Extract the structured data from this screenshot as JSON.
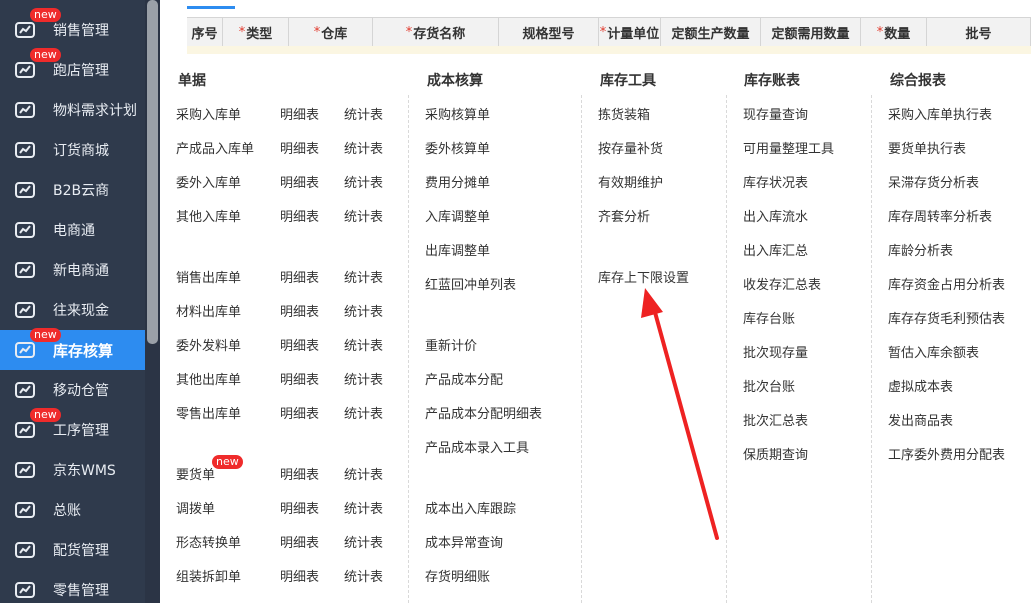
{
  "sidebar": {
    "items": [
      {
        "label": "销售管理",
        "icon": "sales-chart-icon",
        "new": true
      },
      {
        "label": "跑店管理",
        "icon": "store-visit-icon",
        "new": true
      },
      {
        "label": "物料需求计划",
        "icon": "material-plan-icon",
        "new": false
      },
      {
        "label": "订货商城",
        "icon": "mall-icon",
        "new": false
      },
      {
        "label": "B2B云商",
        "icon": "b2b-icon",
        "new": false
      },
      {
        "label": "电商通",
        "icon": "ecommerce-icon",
        "new": false
      },
      {
        "label": "新电商通",
        "icon": "new-ecommerce-icon",
        "new": false
      },
      {
        "label": "往来现金",
        "icon": "cash-transfer-icon",
        "new": false
      },
      {
        "label": "库存核算",
        "icon": "inventory-icon",
        "new": true,
        "active": true
      },
      {
        "label": "移动仓管",
        "icon": "mobile-warehouse-icon",
        "new": false
      },
      {
        "label": "工序管理",
        "icon": "process-icon",
        "new": true
      },
      {
        "label": "京东WMS",
        "icon": "truck-icon",
        "new": false
      },
      {
        "label": "总账",
        "icon": "ledger-icon",
        "new": false
      },
      {
        "label": "配货管理",
        "icon": "distribution-icon",
        "new": false
      },
      {
        "label": "零售管理",
        "icon": "retail-icon",
        "new": false
      }
    ],
    "new_badge": "new"
  },
  "grid": {
    "headers": [
      {
        "label": "序号",
        "required": false
      },
      {
        "label": "类型",
        "required": true
      },
      {
        "label": "仓库",
        "required": true
      },
      {
        "label": "存货名称",
        "required": true
      },
      {
        "label": "规格型号",
        "required": false
      },
      {
        "label": "计量单位",
        "required": true
      },
      {
        "label": "定额生产数量",
        "required": false
      },
      {
        "label": "定额需用数量",
        "required": false
      },
      {
        "label": "数量",
        "required": true
      },
      {
        "label": "批号",
        "required": false
      }
    ]
  },
  "menu": {
    "columns": {
      "documents": {
        "title": "单据",
        "rows": [
          {
            "name": "采购入库单",
            "detail": "明细表",
            "stats": "统计表"
          },
          {
            "name": "产成品入库单",
            "detail": "明细表",
            "stats": "统计表"
          },
          {
            "name": "委外入库单",
            "detail": "明细表",
            "stats": "统计表"
          },
          {
            "name": "其他入库单",
            "detail": "明细表",
            "stats": "统计表"
          },
          {
            "name": "销售出库单",
            "detail": "明细表",
            "stats": "统计表"
          },
          {
            "name": "材料出库单",
            "detail": "明细表",
            "stats": "统计表"
          },
          {
            "name": "委外发料单",
            "detail": "明细表",
            "stats": "统计表"
          },
          {
            "name": "其他出库单",
            "detail": "明细表",
            "stats": "统计表"
          },
          {
            "name": "零售出库单",
            "detail": "明细表",
            "stats": "统计表"
          },
          {
            "name": "要货单",
            "detail": "明细表",
            "stats": "统计表",
            "new": true
          },
          {
            "name": "调拨单",
            "detail": "明细表",
            "stats": "统计表"
          },
          {
            "name": "形态转换单",
            "detail": "明细表",
            "stats": "统计表"
          },
          {
            "name": "组装拆卸单",
            "detail": "明细表",
            "stats": "统计表"
          }
        ]
      },
      "costing": {
        "title": "成本核算",
        "items": [
          "采购核算单",
          "委外核算单",
          "费用分摊单",
          "入库调整单",
          "出库调整单",
          "红蓝回冲单列表",
          "重新计价",
          "产品成本分配",
          "产品成本分配明细表",
          "产品成本录入工具",
          "成本出入库跟踪",
          "成本异常查询",
          "存货明细账"
        ]
      },
      "tools": {
        "title": "库存工具",
        "items": [
          "拣货装箱",
          "按存量补货",
          "有效期维护",
          "齐套分析",
          "库存上下限设置"
        ]
      },
      "ledger": {
        "title": "库存账表",
        "items": [
          "现存量查询",
          "可用量整理工具",
          "库存状况表",
          "出入库流水",
          "出入库汇总",
          "收发存汇总表",
          "库存台账",
          "批次现存量",
          "批次台账",
          "批次汇总表",
          "保质期查询"
        ]
      },
      "reports": {
        "title": "综合报表",
        "items": [
          "采购入库单执行表",
          "要货单执行表",
          "呆滞存货分析表",
          "库存周转率分析表",
          "库龄分析表",
          "库存资金占用分析表",
          "库存存货毛利预估表",
          "暂估入库余额表",
          "虚拟成本表",
          "发出商品表",
          "工序委外费用分配表"
        ]
      }
    }
  },
  "colors": {
    "sidebar_bg": "#2f3a4c",
    "active": "#2d8cf0",
    "badge": "#ef2b2b",
    "arrow": "#ee2222"
  }
}
